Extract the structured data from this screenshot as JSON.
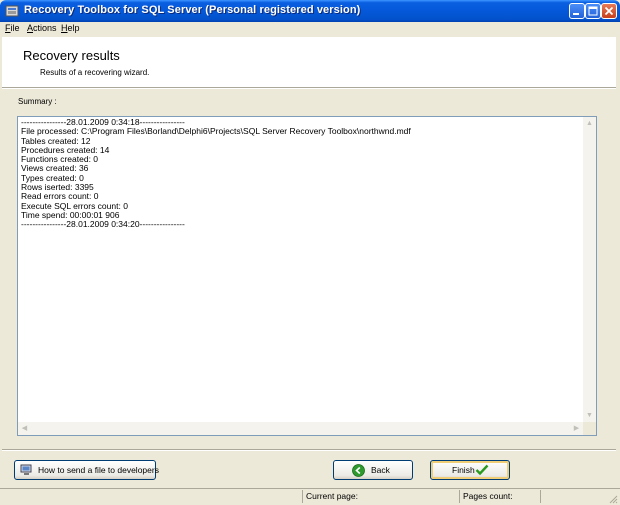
{
  "window": {
    "title": "Recovery Toolbox for SQL Server (Personal registered version)"
  },
  "menu": [
    {
      "label": "File"
    },
    {
      "label": "Actions"
    },
    {
      "label": "Help"
    }
  ],
  "header": {
    "title": "Recovery results",
    "subtitle": "Results of a recovering wizard."
  },
  "summary": {
    "label": "Summary :",
    "lines": [
      "----------------28.01.2009 0:34:18----------------",
      "File processed: C:\\Program Files\\Borland\\Delphi6\\Projects\\SQL Server Recovery Toolbox\\northwnd.mdf",
      "Tables created: 12",
      "Procedures created: 14",
      "Functions created: 0",
      "Views created: 36",
      "Types created: 0",
      "Rows iserted: 3395",
      "Read errors count: 0",
      "Execute SQL errors count: 0",
      "Time spend: 00:00:01 906",
      "----------------28.01.2009 0:34:20----------------"
    ]
  },
  "buttons": {
    "send_file": "How to send a file to developers",
    "back": "Back",
    "finish": "Finish"
  },
  "status": {
    "current_page": "Current page:",
    "pages_count": "Pages count:"
  },
  "colors": {
    "titlebar": "#0458d9",
    "background": "#ece9d8",
    "back_icon": "#2e9a2e",
    "finish_check": "#2a9a1f"
  }
}
